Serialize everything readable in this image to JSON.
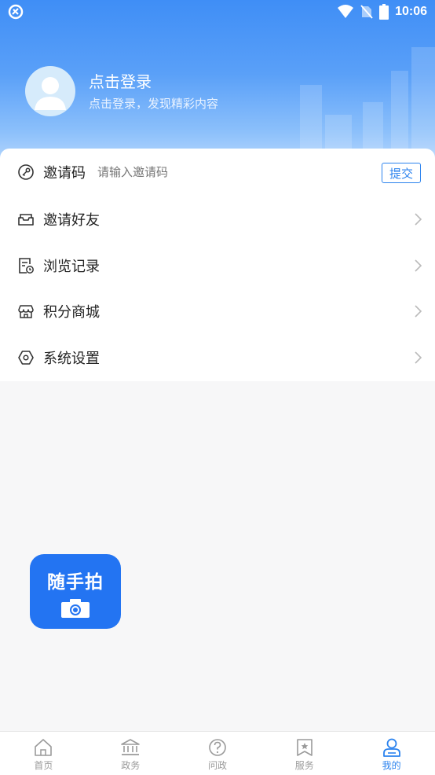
{
  "status_bar": {
    "time": "10:06"
  },
  "profile": {
    "title": "点击登录",
    "subtitle": "点击登录，发现精彩内容"
  },
  "invite": {
    "label": "邀请码",
    "placeholder": "请输入邀请码",
    "submit_label": "提交"
  },
  "menu": [
    {
      "label": "邀请好友",
      "icon": "mail-icon"
    },
    {
      "label": "浏览记录",
      "icon": "history-icon"
    },
    {
      "label": "积分商城",
      "icon": "store-icon"
    },
    {
      "label": "系统设置",
      "icon": "settings-icon"
    }
  ],
  "floating": {
    "label": "随手拍",
    "icon": "camera-icon"
  },
  "tabs": [
    {
      "label": "首页",
      "icon": "home-icon",
      "active": false
    },
    {
      "label": "政务",
      "icon": "government-icon",
      "active": false
    },
    {
      "label": "问政",
      "icon": "question-icon",
      "active": false
    },
    {
      "label": "服务",
      "icon": "service-icon",
      "active": false
    },
    {
      "label": "我的",
      "icon": "user-icon",
      "active": true
    }
  ],
  "colors": {
    "accent": "#2c83ee",
    "header_top": "#3f8ef6",
    "floating_bg": "#2374f2"
  }
}
